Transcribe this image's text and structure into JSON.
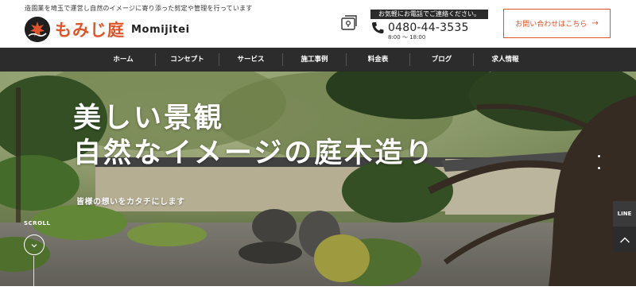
{
  "header": {
    "tagline": "造園業を埼玉で運営し自然のイメージに寄り添った剪定や管理を行っています",
    "logo_name": "もみじ庭",
    "logo_en": "Momijitei",
    "tel_note": "お気軽にお電話でご連絡ください。",
    "tel_number": "0480-44-3535",
    "tel_hours": "8:00 ～ 18:00",
    "contact_label": "お問い合わせはこちら",
    "contact_arrow": "→"
  },
  "nav": {
    "items": [
      "ホーム",
      "コンセプト",
      "サービス",
      "施工事例",
      "料金表",
      "ブログ",
      "求人情報"
    ]
  },
  "hero": {
    "title_line1": "美しい景観",
    "title_line2": "自然なイメージの庭木造り",
    "subtitle": "皆様の想いをカタチにします",
    "scroll_label": "SCROLL"
  },
  "side": {
    "line_label": "LINE"
  },
  "colors": {
    "accent": "#e0542a",
    "nav_bg": "#2c2c2c"
  }
}
